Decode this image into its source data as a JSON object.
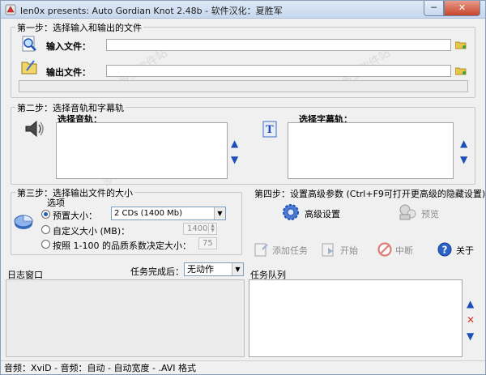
{
  "window": {
    "title": "len0x presents: Auto Gordian Knot 2.48b - 软件汉化：夏胜军",
    "min_label": "─",
    "close_label": "✕"
  },
  "step1": {
    "title": "第一步：选择输入和输出的文件",
    "input_label": "输入文件：",
    "input_value": "",
    "output_label": "输出文件：",
    "output_value": ""
  },
  "step2": {
    "title": "第二步：选择音轨和字幕轨",
    "audio_label": "选择音轨：",
    "subtitle_label": "选择字幕轨："
  },
  "step3": {
    "title": "第三步：选择输出文件的大小",
    "options_label": "选项",
    "preset_label": "预置大小：",
    "preset_value": "2 CDs (1400 Mb)",
    "custom_label": "自定义大小 (MB)：",
    "custom_value": "1400",
    "quality_label": "按照 1-100 的品质系数决定大小：",
    "quality_value": "75"
  },
  "step4": {
    "title": "第四步：设置高级参数 (Ctrl+F9可打开更高级的隐藏设置)",
    "advanced_label": "高级设置",
    "preview_label": "预览"
  },
  "actions": {
    "add_task": "添加任务",
    "start": "开始",
    "abort": "中断",
    "about": "关于"
  },
  "log": {
    "title": "日志窗口",
    "on_complete_label": "任务完成后：",
    "on_complete_value": "无动作"
  },
  "queue": {
    "title": "任务队列"
  },
  "status": {
    "text": "音频：XviD - 音频：自动 - 自动宽度 - .AVI 格式"
  },
  "watermark": "多多软件站",
  "colors": {
    "accent": "#1e4fb8",
    "close": "#c6452a",
    "abort": "#d9302a"
  }
}
